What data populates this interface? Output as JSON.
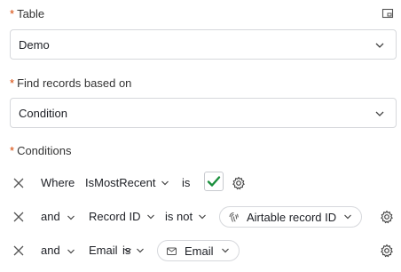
{
  "table": {
    "label": "Table",
    "value": "Demo"
  },
  "find": {
    "label": "Find records based on",
    "value": "Condition"
  },
  "conditions": {
    "label": "Conditions",
    "rows": [
      {
        "conj": "Where",
        "field": "IsMostRecent",
        "op": "is",
        "value_checked": true
      },
      {
        "conj": "and",
        "field": "Record ID",
        "op": "is not",
        "value": "Airtable record ID"
      },
      {
        "conj": "and",
        "field": "Email",
        "op": "is",
        "value": "Email"
      }
    ]
  },
  "required_marker": "*",
  "icons": {
    "corner": "expand-icon",
    "remove": "close-icon",
    "settings": "gear-icon",
    "record_id": "fingerprint-icon",
    "email": "envelope-icon",
    "check": "check-icon"
  },
  "colors": {
    "required": "#d54401",
    "check": "#1a8f3c",
    "border": "#d6d8dc"
  }
}
